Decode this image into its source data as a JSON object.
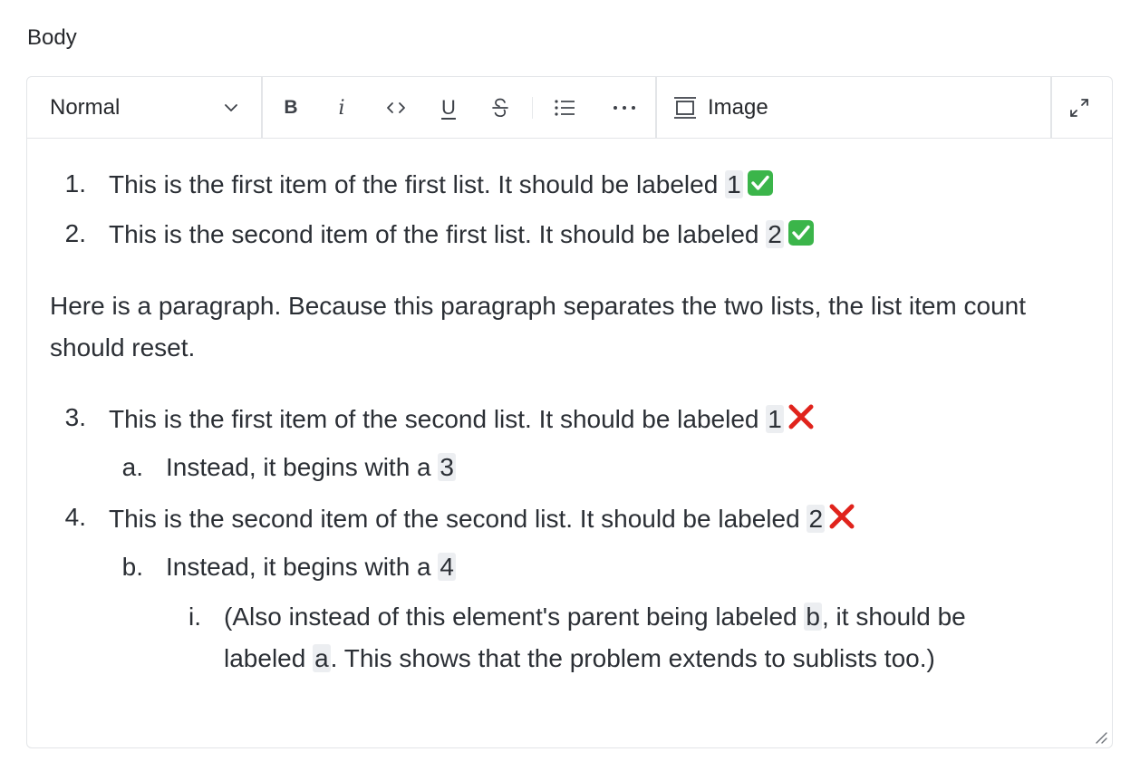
{
  "field": {
    "label": "Body"
  },
  "toolbar": {
    "format_value": "Normal",
    "bold_label": "B",
    "italic_label": "i",
    "underline_label": "U",
    "image_label": "Image",
    "icons": {
      "format_dropdown": "chevron-down-icon",
      "code": "code-icon",
      "strikethrough": "strikethrough-icon",
      "list": "list-icon",
      "more": "ellipsis-icon",
      "image": "image-icon",
      "expand": "expand-icon"
    }
  },
  "content": {
    "list1": [
      {
        "number": "1.",
        "text": "This is the first item of the first list. It should be labeled ",
        "code": "1",
        "status": "check"
      },
      {
        "number": "2.",
        "text": "This is the second item of the first list. It should be labeled ",
        "code": "2",
        "status": "check"
      }
    ],
    "paragraph": "Here is a paragraph. Because this paragraph separates the two lists, the list item count should reset.",
    "list2": [
      {
        "number": "3.",
        "text": "This is the first item of the second list. It should be labeled ",
        "code": "1",
        "status": "cross",
        "sub": {
          "number": "a.",
          "text": "Instead, it begins with a ",
          "code": "3"
        }
      },
      {
        "number": "4.",
        "text": "This is the second item of the second list. It should be labeled ",
        "code": "2",
        "status": "cross",
        "sub": {
          "number": "b.",
          "text": "Instead, it begins with a ",
          "code": "4",
          "sub": {
            "number": "i.",
            "line1_pre": "(Also instead of this element's parent being labeled ",
            "line1_code": "b",
            "line1_post": ", it should be",
            "line2_pre": "labeled ",
            "line2_code": "a",
            "line2_post": ". This shows that the problem extends to sublists too.)"
          }
        }
      }
    ]
  },
  "colors": {
    "check_green": "#3bb54a",
    "cross_red": "#e0231c",
    "border": "#e3e5e8",
    "inline_code_bg": "#eceef1"
  }
}
